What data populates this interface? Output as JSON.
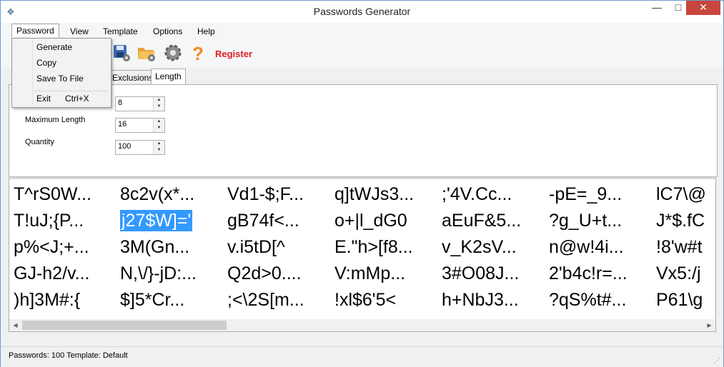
{
  "window": {
    "title": "Passwords Generator"
  },
  "menu": {
    "items": [
      "Password",
      "View",
      "Template",
      "Options",
      "Help"
    ],
    "open_menu": {
      "items": [
        {
          "label": "Generate",
          "shortcut": ""
        },
        {
          "label": "Copy",
          "shortcut": ""
        },
        {
          "label": "Save To File",
          "shortcut": ""
        },
        {
          "label": "Exit",
          "shortcut": "Ctrl+X"
        }
      ]
    }
  },
  "toolbar": {
    "icons": [
      "save-settings-icon",
      "open-folder-icon",
      "gear-icon",
      "help-icon"
    ],
    "register_label": "Register"
  },
  "tabs": [
    {
      "label": "Exclusions",
      "selected": false
    },
    {
      "label": "Length",
      "selected": true
    }
  ],
  "length": {
    "minimum_value": "8",
    "maximum_label": "Maximum Length",
    "maximum_value": "16",
    "quantity_label": "Quantity",
    "quantity_value": "100"
  },
  "passwords": [
    [
      "T^rS0W...",
      "8c2v(x*...",
      "Vd1-$;F...",
      "q]tWJs3...",
      ";'4V.Cc...",
      "-pE=_9...",
      "lC7\\@"
    ],
    [
      "T!uJ;{P...",
      "j27$W]='",
      "gB74f<...",
      "o+|l_dG0",
      "aEuF&5...",
      "?g_U+t...",
      "J*$.fC"
    ],
    [
      "p%<J;+...",
      "3M(Gn...",
      "v.i5tD[^",
      "E.\"h>[f8...",
      "v_K2sV...",
      "n@w!4i...",
      "!8'w#t"
    ],
    [
      "GJ-h2/v...",
      "N,\\/}-jD:...",
      "Q2d>0....",
      "V:mMp...",
      "3#O08J...",
      "2'b4c!r=...",
      "Vx5:/j"
    ],
    [
      ")h]3M#:{",
      "$]5*Cr...",
      ";<\\2S[m...",
      "!xl$6'5<",
      "h+NbJ3...",
      "?qS%t#...",
      "P61\\g"
    ]
  ],
  "selected_password": "j27$W]='",
  "status": {
    "text": "Passwords: 100  Template: Default"
  }
}
